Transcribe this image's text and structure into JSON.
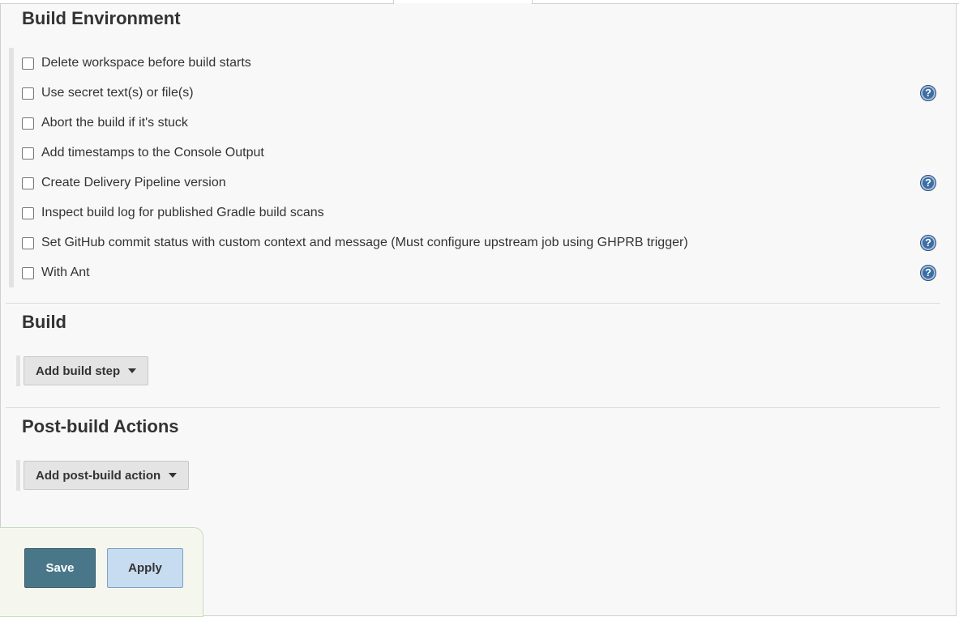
{
  "sections": {
    "build_environment": {
      "title": "Build Environment",
      "options": [
        {
          "label": "Delete workspace before build starts",
          "checked": false,
          "has_help": false
        },
        {
          "label": "Use secret text(s) or file(s)",
          "checked": false,
          "has_help": true
        },
        {
          "label": "Abort the build if it's stuck",
          "checked": false,
          "has_help": false
        },
        {
          "label": "Add timestamps to the Console Output",
          "checked": false,
          "has_help": false
        },
        {
          "label": "Create Delivery Pipeline version",
          "checked": false,
          "has_help": true
        },
        {
          "label": "Inspect build log for published Gradle build scans",
          "checked": false,
          "has_help": false
        },
        {
          "label": "Set GitHub commit status with custom context and message (Must configure upstream job using GHPRB trigger)",
          "checked": false,
          "has_help": true
        },
        {
          "label": "With Ant",
          "checked": false,
          "has_help": true
        }
      ]
    },
    "build": {
      "title": "Build",
      "add_button": "Add build step"
    },
    "post_build": {
      "title": "Post-build Actions",
      "add_button": "Add post-build action"
    }
  },
  "help_icon_glyph": "?",
  "footer": {
    "save_label": "Save",
    "apply_label": "Apply"
  },
  "colors": {
    "save_bg": "#497789",
    "apply_bg": "#c7dcf0",
    "help_icon": "#3c6ea3"
  }
}
